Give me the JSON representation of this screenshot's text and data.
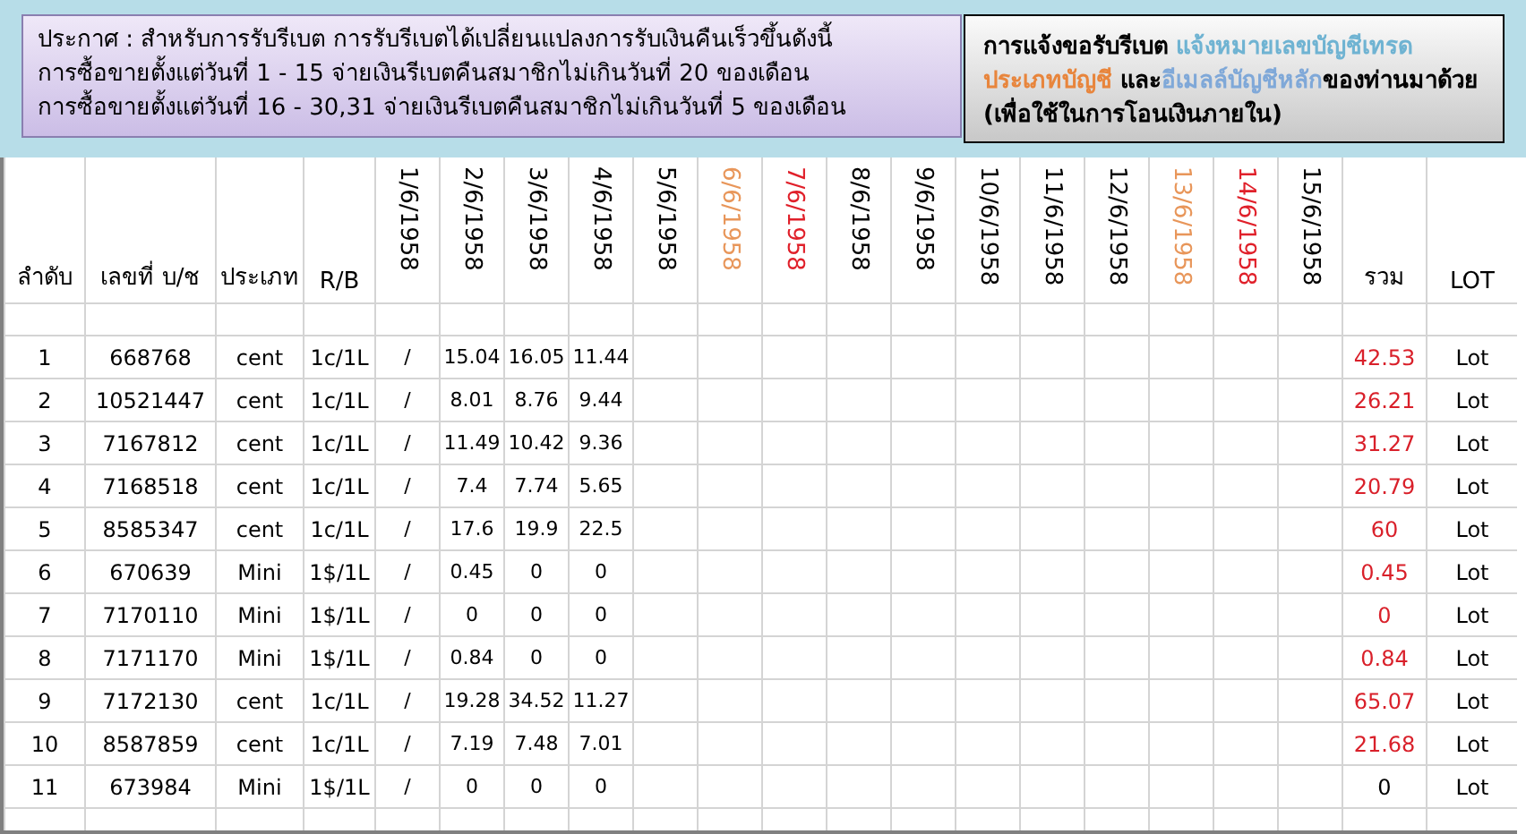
{
  "notice": {
    "lines": [
      "ประกาศ : สำหรับการรับรีเบต  การรับรีเบตได้เปลี่ยนแปลงการรับเงินคืนเร็วขึ้นดังนี้",
      "การซื้อขายตั้งแต่วันที่   1 - 15  จ่ายเงินรีเบตคืนสมาชิกไม่เกินวันที่ 20 ของเดือน",
      "การซื้อขายตั้งแต่วันที่ 16 - 30,31 จ่ายเงินรีเบตคืนสมาชิกไม่เกินวันที่  5  ของเดือน"
    ]
  },
  "request": {
    "segments": [
      {
        "text": "การแจ้งขอรับรีเบต  ",
        "color": "#000000"
      },
      {
        "text": "แจ้งหมายเลขบัญชีเทรด ",
        "color": "#6fb3d2"
      },
      {
        "text": "ประเภทบัญชี",
        "color": "#e8853c"
      },
      {
        "text": " และ",
        "color": "#000000"
      },
      {
        "text": "อีเมลล์บัญชีหลัก",
        "color": "#7fa8d8"
      },
      {
        "text": "ของท่านมาด้วย   (เพื่อใช้ในการโอนเงินภายใน)",
        "color": "#000000"
      }
    ]
  },
  "table": {
    "columns": [
      {
        "label": "ลำดับ",
        "kind": "plain"
      },
      {
        "label": "เลขที่ บ/ช",
        "kind": "plain"
      },
      {
        "label": "ประเภท",
        "kind": "plain"
      },
      {
        "label": "R/B",
        "kind": "plain"
      },
      {
        "label": "1/6/1958",
        "kind": "date",
        "color": "#000000"
      },
      {
        "label": "2/6/1958",
        "kind": "date",
        "color": "#000000"
      },
      {
        "label": "3/6/1958",
        "kind": "date",
        "color": "#000000"
      },
      {
        "label": "4/6/1958",
        "kind": "date",
        "color": "#000000"
      },
      {
        "label": "5/6/1958",
        "kind": "date",
        "color": "#000000"
      },
      {
        "label": "6/6/1958",
        "kind": "date",
        "color": "#e8965a"
      },
      {
        "label": "7/6/1958",
        "kind": "date",
        "color": "#e0202a"
      },
      {
        "label": "8/6/1958",
        "kind": "date",
        "color": "#000000"
      },
      {
        "label": "9/6/1958",
        "kind": "date",
        "color": "#000000"
      },
      {
        "label": "10/6/1958",
        "kind": "date",
        "color": "#000000"
      },
      {
        "label": "11/6/1958",
        "kind": "date",
        "color": "#000000"
      },
      {
        "label": "12/6/1958",
        "kind": "date",
        "color": "#000000"
      },
      {
        "label": "13/6/1958",
        "kind": "date",
        "color": "#e8965a"
      },
      {
        "label": "14/6/1958",
        "kind": "date",
        "color": "#e0202a"
      },
      {
        "label": "15/6/1958",
        "kind": "date",
        "color": "#000000"
      },
      {
        "label": "รวม",
        "kind": "plain"
      },
      {
        "label": "LOT",
        "kind": "plain"
      }
    ],
    "rows": [
      {
        "no": "1",
        "account": "668768",
        "type": "cent",
        "rb": "1c/1L",
        "days": [
          "/",
          "15.04",
          "16.05",
          "11.44"
        ],
        "total": "42.53",
        "color": "#d9202a",
        "lot": "Lot"
      },
      {
        "no": "2",
        "account": "10521447",
        "type": "cent",
        "rb": "1c/1L",
        "days": [
          "/",
          "8.01",
          "8.76",
          "9.44"
        ],
        "total": "26.21",
        "color": "#d9202a",
        "lot": "Lot"
      },
      {
        "no": "3",
        "account": "7167812",
        "type": "cent",
        "rb": "1c/1L",
        "days": [
          "/",
          "11.49",
          "10.42",
          "9.36"
        ],
        "total": "31.27",
        "color": "#d9202a",
        "lot": "Lot"
      },
      {
        "no": "4",
        "account": "7168518",
        "type": "cent",
        "rb": "1c/1L",
        "days": [
          "/",
          "7.4",
          "7.74",
          "5.65"
        ],
        "total": "20.79",
        "color": "#d9202a",
        "lot": "Lot"
      },
      {
        "no": "5",
        "account": "8585347",
        "type": "cent",
        "rb": "1c/1L",
        "days": [
          "/",
          "17.6",
          "19.9",
          "22.5"
        ],
        "total": "60",
        "color": "#d9202a",
        "lot": "Lot"
      },
      {
        "no": "6",
        "account": "670639",
        "type": "Mini",
        "rb": "1$/1L",
        "days": [
          "/",
          "0.45",
          "0",
          "0"
        ],
        "total": "0.45",
        "color": "#d9202a",
        "lot": "Lot"
      },
      {
        "no": "7",
        "account": "7170110",
        "type": "Mini",
        "rb": "1$/1L",
        "days": [
          "/",
          "0",
          "0",
          "0"
        ],
        "total": "0",
        "color": "#d9202a",
        "lot": "Lot"
      },
      {
        "no": "8",
        "account": "7171170",
        "type": "Mini",
        "rb": "1$/1L",
        "days": [
          "/",
          "0.84",
          "0",
          "0"
        ],
        "total": "0.84",
        "color": "#d9202a",
        "lot": "Lot"
      },
      {
        "no": "9",
        "account": "7172130",
        "type": "cent",
        "rb": "1c/1L",
        "days": [
          "/",
          "19.28",
          "34.52",
          "11.27"
        ],
        "total": "65.07",
        "color": "#d9202a",
        "lot": "Lot"
      },
      {
        "no": "10",
        "account": "8587859",
        "type": "cent",
        "rb": "1c/1L",
        "days": [
          "/",
          "7.19",
          "7.48",
          "7.01"
        ],
        "total": "21.68",
        "color": "#d9202a",
        "lot": "Lot"
      },
      {
        "no": "11",
        "account": "673984",
        "type": "Mini",
        "rb": "1$/1L",
        "days": [
          "/",
          "0",
          "0",
          "0"
        ],
        "total": "0",
        "color": "#000000",
        "lot": "Lot"
      }
    ]
  }
}
